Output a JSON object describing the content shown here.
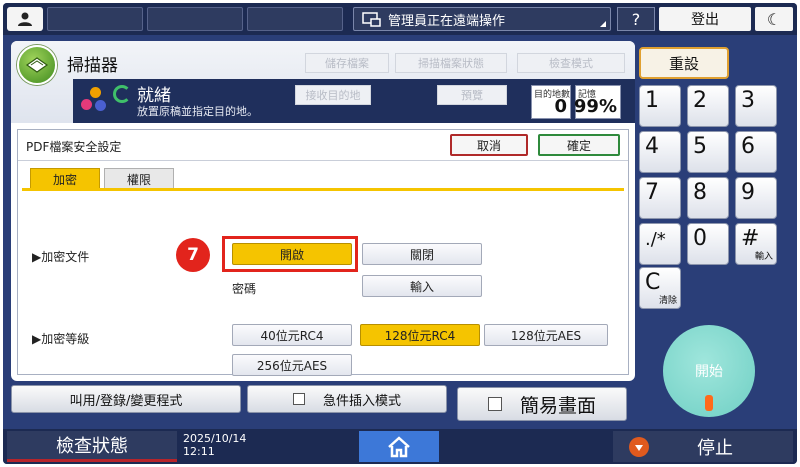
{
  "topbar": {
    "status": "管理員正在遠端操作",
    "help": "?",
    "logout": "登出"
  },
  "app": {
    "title": "掃描器",
    "header_buttons": [
      "儲存檔案",
      "掃描檔案狀態",
      "檢查模式",
      "接收目的地",
      "預覽"
    ],
    "status": "就緒",
    "status_sub": "放置原稿並指定目的地。",
    "dest_count_label": "目的地數",
    "dest_count": "0",
    "memory_label": "記憶",
    "memory": "99%"
  },
  "dialog": {
    "title": "PDF檔案安全設定",
    "cancel": "取消",
    "ok": "確定",
    "tabs": [
      {
        "label": "加密",
        "active": true
      },
      {
        "label": "權限",
        "active": false
      }
    ],
    "encrypt_label": "▶加密文件",
    "on": "開啟",
    "off": "關閉",
    "password_label": "密碼",
    "input": "輸入",
    "level_label": "▶加密等級",
    "levels": [
      "40位元RC4",
      "128位元RC4",
      "128位元AES",
      "256位元AES"
    ],
    "selected_level": "128位元RC4",
    "step": "7"
  },
  "keypad": {
    "reset": "重設",
    "keys": [
      "1",
      "2",
      "3",
      "4",
      "5",
      "6",
      "7",
      "8",
      "9",
      "./*",
      "0",
      "#",
      "C"
    ],
    "hash_sub": "輸入",
    "clear_sub": "清除",
    "start": "開始"
  },
  "bottom": {
    "recall": "叫用/登錄/變更程式",
    "interrupt": "急件插入模式",
    "simple": "簡易畫面"
  },
  "footer": {
    "check_status": "檢查狀態",
    "date": "2025/10/14",
    "time": "12:11",
    "stop": "停止"
  },
  "colors": {
    "accent_yellow": "#f5c400",
    "highlight_red": "#e2241c",
    "header_navy": "#1c2a52"
  }
}
